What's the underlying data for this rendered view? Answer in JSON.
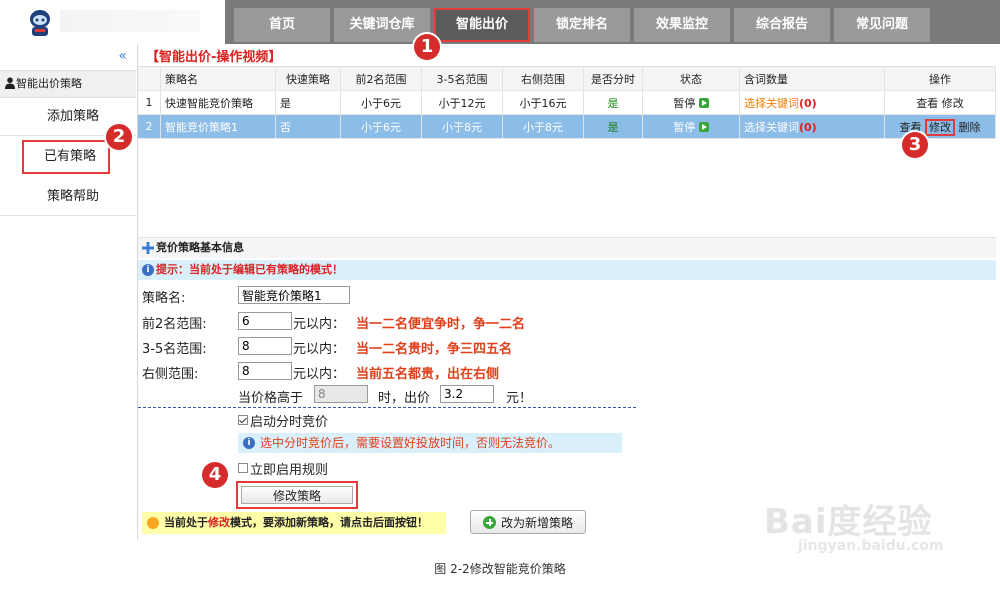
{
  "nav": {
    "items": [
      "首页",
      "关键词仓库",
      "智能出价",
      "锁定排名",
      "效果监控",
      "综合报告",
      "常见问题"
    ],
    "active": "智能出价"
  },
  "sidebar": {
    "collapse": "«",
    "header": "智能出价策略",
    "items": [
      "添加策略",
      "已有策略",
      "策略帮助"
    ]
  },
  "badges": [
    "1",
    "2",
    "3",
    "4"
  ],
  "main": {
    "video_link": "【智能出价-操作视频】",
    "table": {
      "headers": [
        "",
        "策略名",
        "快速策略",
        "前2名范围",
        "3-5名范围",
        "右侧范围",
        "是否分时",
        "状态",
        "含词数量",
        "操作"
      ],
      "rows": [
        {
          "num": "1",
          "name": "快速智能竞价策略",
          "quick": "是",
          "top2": "小于6元",
          "top35": "小于12元",
          "right": "小于16元",
          "timeshare": "是",
          "status": "暂停",
          "keyword_link": "选择关键词",
          "keyword_count": "(0)",
          "op_view": "查看",
          "op_edit": "修改",
          "op_delete": ""
        },
        {
          "num": "2",
          "name": "智能竞价策略1",
          "quick": "否",
          "top2": "小于6元",
          "top35": "小于8元",
          "right": "小于8元",
          "timeshare": "是",
          "status": "暂停",
          "keyword_link": "选择关键词",
          "keyword_count": "(0)",
          "op_view": "查看",
          "op_edit": "修改",
          "op_delete": "删除"
        }
      ]
    },
    "section_title": "竞价策略基本信息",
    "tip": "提示：当前处于编辑已有策略的模式！",
    "form": {
      "name_label": "策略名:",
      "name_value": "智能竞价策略1",
      "top2_label": "前2名范围:",
      "top2_value": "6",
      "top2_unit": "元以内：",
      "top2_hint": "当一二名便宜争时，争一二名",
      "top35_label": "3-5名范围:",
      "top35_value": "8",
      "top35_unit": "元以内：",
      "top35_hint": "当一二名贵时，争三四五名",
      "right_label": "右侧范围:",
      "right_value": "8",
      "right_unit": "元以内：",
      "right_hint": "当前五名都贵，出在右侧",
      "price_above": "当价格高于",
      "price_above_value": "8",
      "price_bid": "时，出价",
      "price_bid_value": "3.2",
      "price_currency": "元！",
      "timeshare_label": "启动分时竞价",
      "timeshare_tip": "选中分时竞价后，需要设置好投放时间，否则无法竞价。",
      "enable_label": "立即启用规则",
      "modify_button": "修改策略"
    },
    "notice": {
      "pre": "当前处于",
      "highlight": "修改",
      "post": "模式，要添加新策略，请点击后面按钮！"
    },
    "new_button": "改为新增策略"
  },
  "watermark": {
    "big": "Bai度经验",
    "small": "jingyan.baidu.com"
  },
  "caption": "图 2-2修改智能竞价策略"
}
